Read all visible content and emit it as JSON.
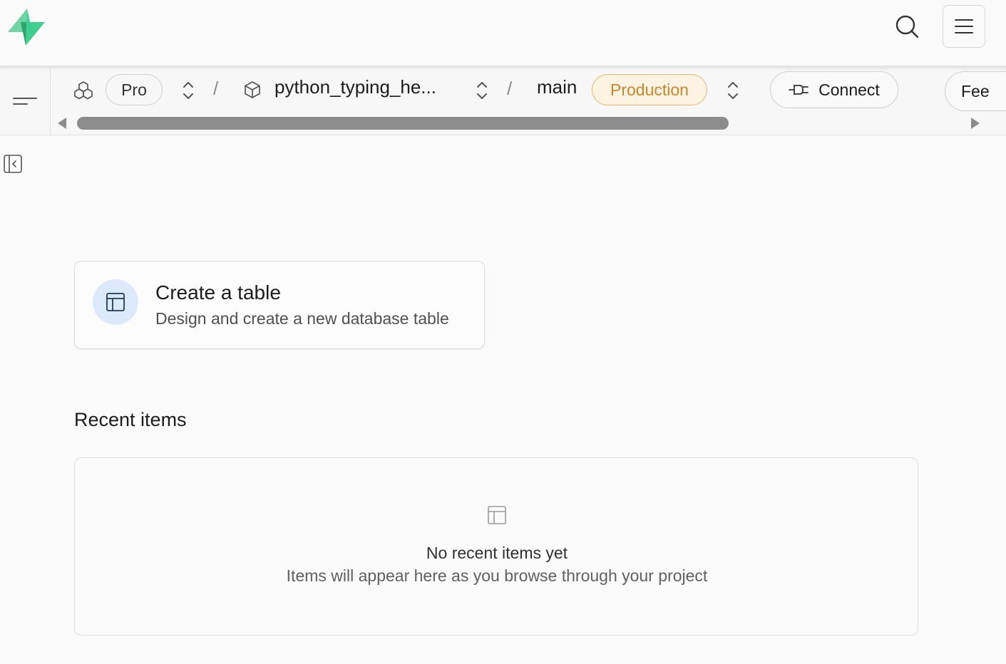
{
  "header": {
    "logo": "supabase-logo-icon",
    "search_icon": "search-icon",
    "menu_icon": "menu-icon"
  },
  "breadcrumb": {
    "org_icon": "org-icon",
    "plan": "Pro",
    "separator": "/",
    "project": "python_typing_he...",
    "branch": "main",
    "environment": "Production",
    "connect": "Connect",
    "feedback": "Fee"
  },
  "main": {
    "create_card": {
      "title": "Create a table",
      "subtitle": "Design and create a new database table"
    },
    "recent": {
      "title": "Recent items",
      "empty_title": "No recent items yet",
      "empty_subtitle": "Items will appear here as you browse through your project"
    }
  },
  "colors": {
    "brand": "#3ecf8e",
    "production_text": "#c9872b",
    "production_bg": "#fdf3e3",
    "card_icon_bg": "#dbe9fb"
  }
}
